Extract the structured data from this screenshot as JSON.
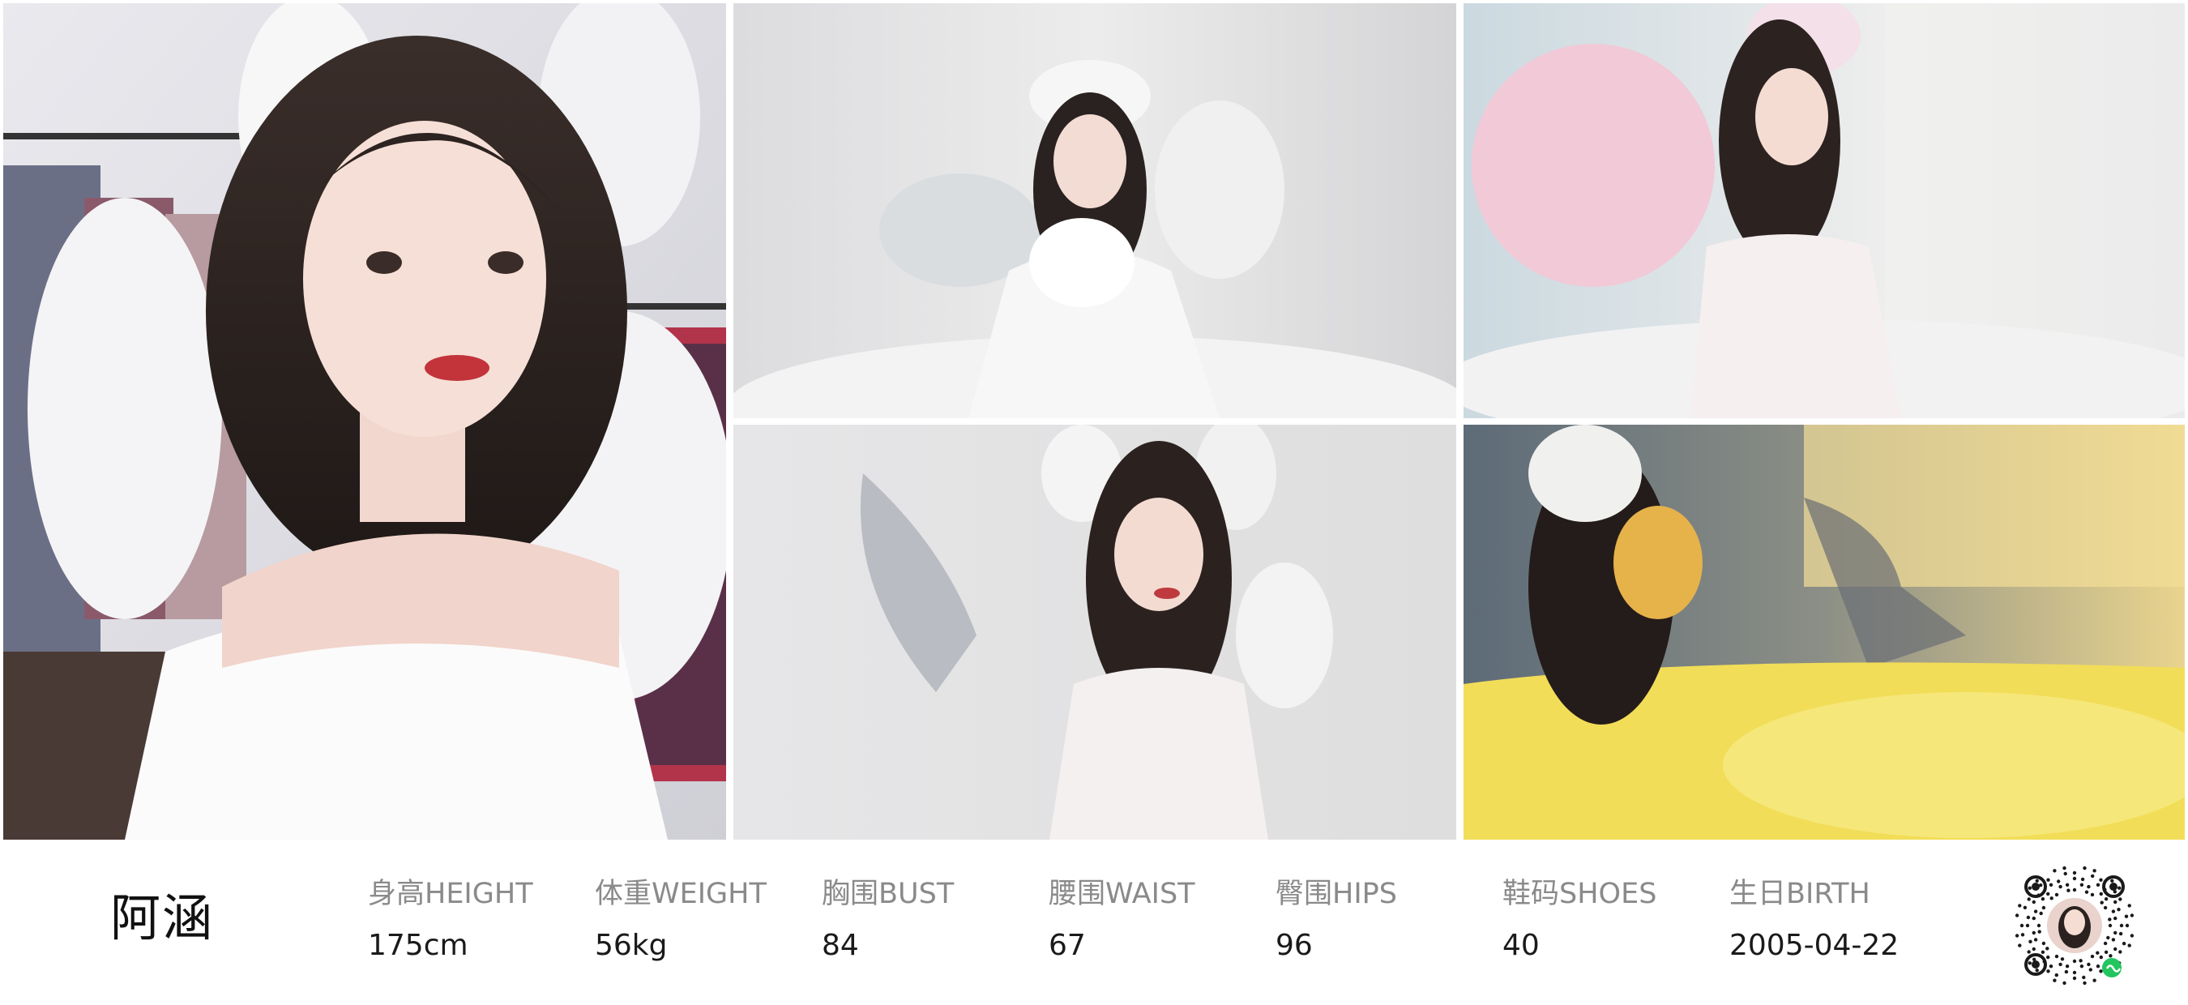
{
  "model": {
    "name": "阿涵"
  },
  "stats": [
    {
      "label": "身高HEIGHT",
      "value": "175cm"
    },
    {
      "label": "体重WEIGHT",
      "value": "56kg"
    },
    {
      "label": "胸围BUST",
      "value": "84"
    },
    {
      "label": "腰围WAIST",
      "value": "67"
    },
    {
      "label": "臀围HIPS",
      "value": "96"
    },
    {
      "label": "鞋码SHOES",
      "value": "40"
    },
    {
      "label": "生日BIRTH",
      "value": "2005-04-22"
    }
  ],
  "colors": {
    "background": "#ffffff",
    "label": "#8a8a8a",
    "value": "#1a1a1a",
    "qr_accent": "#22c55e"
  },
  "icons": {
    "qr": "mini-program-qr-code-icon"
  }
}
